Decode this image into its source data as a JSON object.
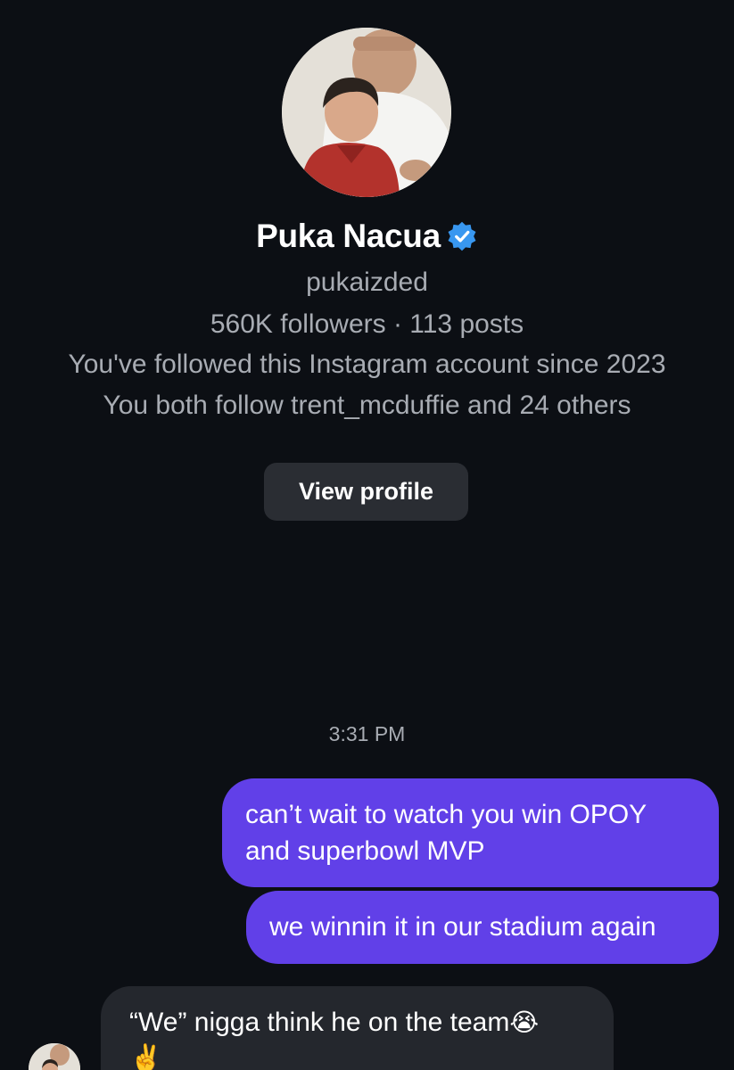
{
  "profile": {
    "name": "Puka Nacua",
    "verified": true,
    "username": "pukaizded",
    "stats": "560K followers · 113 posts",
    "followed_since": "You've followed this Instagram account since 2023",
    "mutual_follows": "You both follow trent_mcduffie and 24 others",
    "view_profile_label": "View profile"
  },
  "conversation": {
    "timestamp": "3:31 PM",
    "messages": [
      {
        "direction": "sent",
        "line1": "can’t wait to watch you win OPOY",
        "line2": "and superbowl MVP"
      },
      {
        "direction": "sent",
        "text": "we winnin it in our stadium again"
      },
      {
        "direction": "received",
        "line1": "“We” nigga think he on the team",
        "emoji1": "😭",
        "emoji2": "✌️"
      }
    ]
  },
  "colors": {
    "background": "#0c0f14",
    "sent_bubble": "#6140e8",
    "received_bubble": "#24272d",
    "button": "#2a2d33",
    "secondary_text": "#a8acb3",
    "verified_badge": "#3897f0"
  },
  "icons": {
    "verified": "verified-badge-icon"
  }
}
